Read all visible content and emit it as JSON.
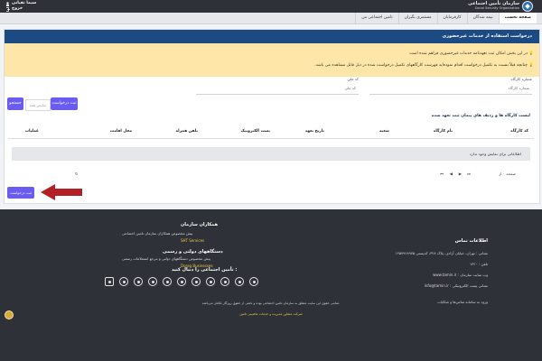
{
  "topbar": {
    "logo_fa": "سازمان تأمین اجتماعی",
    "logo_en": "Social Security Organization",
    "user_name": "سیما تقیانی",
    "logout": "خروج"
  },
  "nav": {
    "items": [
      {
        "label": "صفحه نخست",
        "active": true
      },
      {
        "label": "بیمه شدگان"
      },
      {
        "label": "کارفرمایان"
      },
      {
        "label": "مستمری بگیران"
      },
      {
        "label": "تامین اجتماعی من"
      }
    ]
  },
  "request": {
    "header": "درخواست استفاده از خدمات غیرحضوری",
    "alert_1": "در این بخش امکان ثبت تعهدنامه خدمات غیرحضوری فراهم شده است",
    "alert_2": "چنانچه قبلاً نسبت به تکمیل درخواست اقدام نموده‌اید فهرست کارگاههای تکمیل درخواست شده در ذیل قابل مشاهده می باشد.",
    "workshop_label": "شماره کارگاه",
    "national_label": "کد ملی",
    "national_placeholder": "کد ملی",
    "search_placeholder": "شماره کارگاه",
    "fake_input": "نمایش همه",
    "register_btn": "ثبت درخواست",
    "search_btn": "جستجو"
  },
  "table": {
    "title": "لیست کارگاه ها و ردیف های پیمان ثبت تعهد شده",
    "headers": [
      "کد کارگاه",
      "نام کارگاه",
      "شعبه",
      "تاریخ تعهد",
      "پست الکترونیک",
      "تلفن همراه",
      "محل اقامت",
      "عملیات"
    ],
    "empty_text": "اطلاعاتی برای نمایش وجود ندارد",
    "page_label": "صفحه ۰ از"
  },
  "submit_btn": "ثبت درخواست",
  "footer": {
    "contact_title": "اطلاعات تماس",
    "address": "نشانی : تهران، خیابان آزادی، پلاک ۳۲۸، کدپستی ۱۴۵۷۹۶۸۹۷۵",
    "phone": "تلفن : ۱۴۲۰",
    "website": "وب سایت سازمان : www.tamin.ir",
    "email": "نشانی پست الکترونیکی : info@tamin.ir",
    "complaints": "ورود به سامانه تماس‌ها و شکایات",
    "partners_title": "همکاران سازمان",
    "partners_text": "پیش مخصوص همکاران سازمان تامین اجتماعی",
    "partners_link": "SHT Services",
    "gov_title": "دستگاههای دولتی و رسمی",
    "gov_text": "پیش مخصوص دستگاههای دولتی و مرجع استعلامات رسمی",
    "gov_link": "Doreg Businesses",
    "social_title": "تأمین اجتماعی را دنبال کنید :",
    "socials": [
      "instagram-icon",
      "aparat-icon",
      "twitter-icon",
      "telegram-icon",
      "soroush-icon",
      "eitaa-icon",
      "bale-icon",
      "igap-icon",
      "gap-icon",
      "rubika-icon",
      "linkedin-icon"
    ],
    "copyright": "تمامی حقوق این سایت متعلق به سازمان تامین اجتماعی بوده و ناشی از حقوق روزگار تکامل می‌باشد.",
    "bottom_link": "شرکت مشاور مدیریت و خدمات ماشینی تامین"
  }
}
